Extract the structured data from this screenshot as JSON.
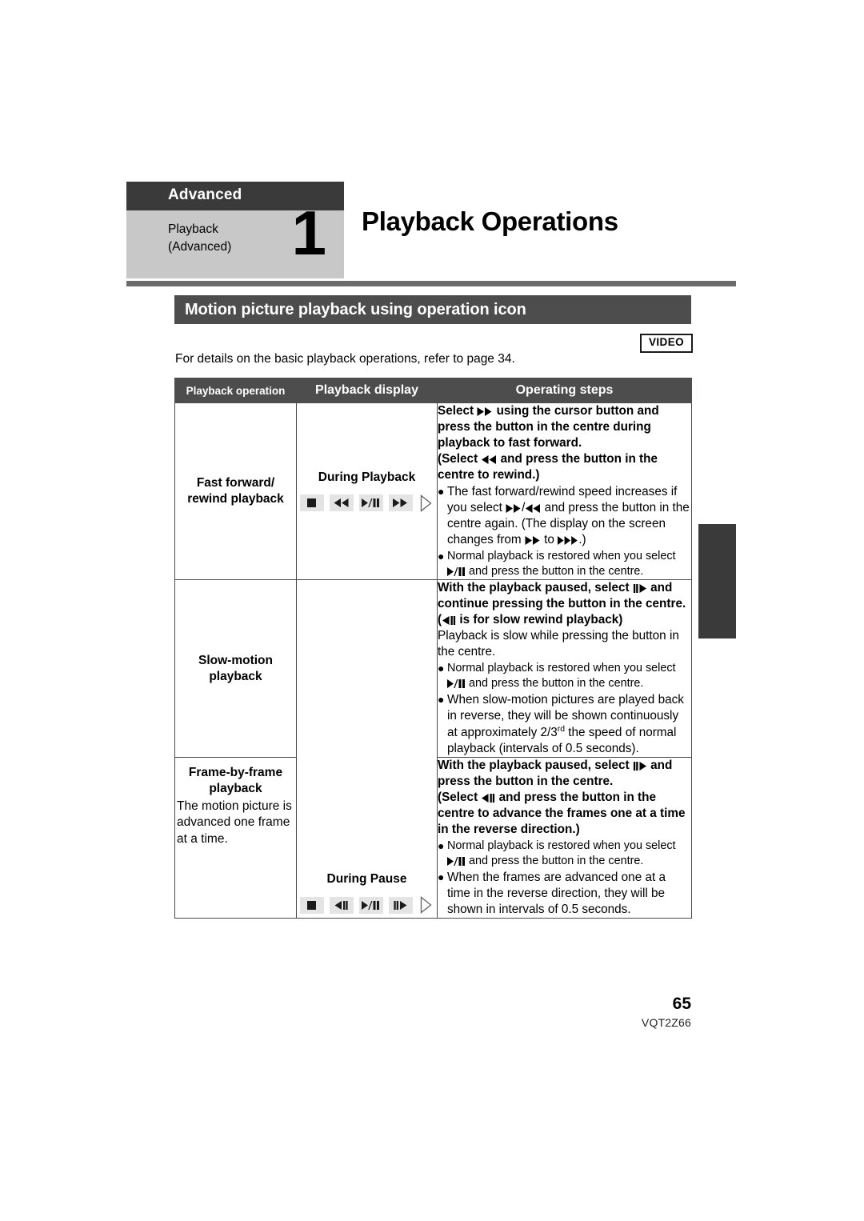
{
  "chapter": {
    "badge_label": "Advanced",
    "subtitle": "Playback\n(Advanced)",
    "subtitle_line1": "Playback",
    "subtitle_line2": "(Advanced)",
    "number": "1",
    "title": "Playback Operations"
  },
  "section": {
    "title": "Motion picture playback using operation icon",
    "media_badge": "VIDEO",
    "intro": "For details on the basic playback operations, refer to page 34."
  },
  "table": {
    "headers": {
      "operation": "Playback operation",
      "display": "Playback display",
      "steps": "Operating steps"
    },
    "rows": [
      {
        "operation_label_line1": "Fast forward/",
        "operation_label_line2": "rewind playback",
        "operation_note": "",
        "display_label": "During Playback",
        "display_icons": [
          "stop-icon",
          "rewind-icon",
          "play-pause-icon",
          "fast-forward-icon",
          "cursor-right-icon"
        ],
        "steps_bold_1": "Select ▶▶ using the cursor button and press the button in the centre during playback to fast forward.",
        "steps_bold_2": "(Select ◀◀ and press the button in the centre to rewind.)",
        "bullet_1": "The fast forward/rewind speed increases if you select ▶▶/◀◀ and press the button in the centre again. (The display on the screen changes from ▶▶ to ▶▶▶.)",
        "bullet_2": "Normal playback is restored when you select ▶/❙❙ and press the button in the centre."
      },
      {
        "operation_label_line1": "Slow-motion",
        "operation_label_line2": "playback",
        "operation_note": "",
        "display_label": "During Pause",
        "display_icons": [
          "stop-icon",
          "slow-rewind-icon",
          "play-pause-icon",
          "slow-forward-icon",
          "cursor-right-icon"
        ],
        "steps_bold_1": "With the playback paused, select ❙❙▶ and continue pressing the button in the centre.",
        "steps_bold_2": "(◀❙❙ is for slow rewind playback)",
        "steps_plain": "Playback is slow while pressing the button in the centre.",
        "bullet_1": "Normal playback is restored when you select ▶/❙❙ and press the button in the centre.",
        "bullet_2": "When slow-motion pictures are played back in reverse, they will be shown continuously at approximately 2/3rd the speed of normal playback (intervals of 0.5 seconds)."
      },
      {
        "operation_label_line1": "Frame-by-frame",
        "operation_label_line2": "playback",
        "operation_note": "The motion picture is advanced one frame at a time.",
        "steps_bold_1": "With the playback paused, select ❙❙▶ and press the button in the centre.",
        "steps_bold_2": "(Select ◀❙❙ and press the button in the centre to advance the frames one at a time in the reverse direction.)",
        "bullet_1": "Normal playback is restored when you select ▶/❙❙ and press the button in the centre.",
        "bullet_2": "When the frames are advanced one at a time in the reverse direction, they will be shown in intervals of 0.5 seconds."
      }
    ]
  },
  "footer": {
    "page_number": "65",
    "doc_code": "VQT2Z66"
  }
}
